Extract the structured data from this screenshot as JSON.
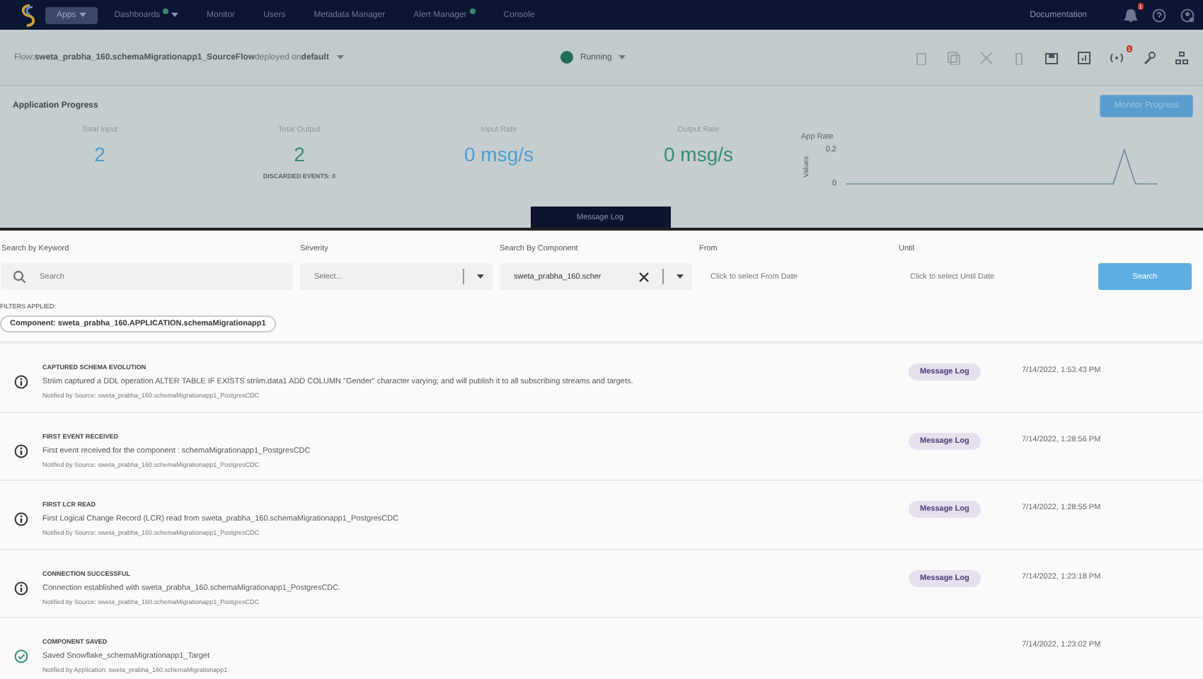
{
  "nav": {
    "items": [
      {
        "label": "Apps",
        "selected": true,
        "caret": true,
        "dot": false
      },
      {
        "label": "Dashboards",
        "selected": false,
        "caret": true,
        "dot": true
      },
      {
        "label": "Monitor",
        "selected": false,
        "caret": false,
        "dot": false
      },
      {
        "label": "Users",
        "selected": false,
        "caret": false,
        "dot": false
      },
      {
        "label": "Metadata Manager",
        "selected": false,
        "caret": false,
        "dot": false
      },
      {
        "label": "Alert Manager",
        "selected": false,
        "caret": false,
        "dot": true
      },
      {
        "label": "Console",
        "selected": false,
        "caret": false,
        "dot": false
      }
    ],
    "documentation": "Documentation",
    "bell_badge": "1"
  },
  "flow_bar": {
    "flow_label": "Flow:",
    "flow_name": "sweta_prabha_160.schemaMigrationapp1_SourceFlow",
    "deployed_on": "deployed on",
    "target": "default",
    "status": "Running",
    "toolbar_badge": "1"
  },
  "progress": {
    "title": "Application Progress",
    "button": "Monitor Progress",
    "stats": [
      {
        "label": "Total Input",
        "value": "2",
        "color": "#4a9fd0"
      },
      {
        "label": "Total Output",
        "value": "2",
        "color": "#2e8f75",
        "note": "DISCARDED EVENTS: 0"
      },
      {
        "label": "Input Rate",
        "value": "0 msg/s",
        "color": "#4a9fd0"
      },
      {
        "label": "Output Rate",
        "value": "0 msg/s",
        "color": "#2e8f75"
      }
    ],
    "chart_data": {
      "type": "line",
      "title": "App Rate",
      "ylabel": "Values",
      "yticks": [
        0,
        0.2
      ],
      "ylim": [
        0,
        0.2
      ],
      "series": [
        {
          "color": "#6a8a9a",
          "values": [
            0,
            0,
            0,
            0,
            0,
            0,
            0,
            0,
            0,
            0,
            0,
            0,
            0,
            0,
            0,
            0,
            0,
            0,
            0,
            0,
            0,
            0,
            0,
            0,
            0,
            0.2,
            0,
            0,
            0
          ]
        }
      ]
    }
  },
  "log_tab": "Message Log",
  "filters": {
    "keyword": {
      "label": "Search by Keyword",
      "placeholder": "Search"
    },
    "severity": {
      "label": "Severity",
      "placeholder": "Select..."
    },
    "component": {
      "label": "Search By Component",
      "value": "sweta_prabha_160.scher"
    },
    "from": {
      "label": "From",
      "placeholder": "Click to select From Date"
    },
    "until": {
      "label": "Until",
      "placeholder": "Click to select Until Date"
    },
    "search_button": "Search",
    "applied_label": "FILTERS APPLIED:",
    "applied": [
      "Component: sweta_prabha_160.APPLICATION.schemaMigrationapp1"
    ]
  },
  "events": [
    {
      "kind": "info",
      "title": "CAPTURED SCHEMA EVOLUTION",
      "message": "Striim captured a DDL operation ALTER TABLE IF EXISTS striim.data1 ADD COLUMN \"Gender\" character varying; and will publish it to all subscribing streams and targets.",
      "source": "Notified by Source: sweta_prabha_160.schemaMigrationapp1_PostgresCDC",
      "button": "Message Log",
      "time": "7/14/2022, 1:53:43 PM"
    },
    {
      "kind": "info",
      "title": "FIRST EVENT RECEIVED",
      "message": "First event received for the component : schemaMigrationapp1_PostgresCDC",
      "source": "Notified by Source: sweta_prabha_160.schemaMigrationapp1_PostgresCDC",
      "button": "Message Log",
      "time": "7/14/2022, 1:28:56 PM"
    },
    {
      "kind": "info",
      "title": "FIRST LCR READ",
      "message": "First Logical Change Record (LCR) read from sweta_prabha_160.schemaMigrationapp1_PostgresCDC",
      "source": "Notified by Source: sweta_prabha_160.schemaMigrationapp1_PostgresCDC",
      "button": "Message Log",
      "time": "7/14/2022, 1:28:55 PM"
    },
    {
      "kind": "info",
      "title": "CONNECTION SUCCESSFUL",
      "message": "Connection established with sweta_prabha_160.schemaMigrationapp1_PostgresCDC.",
      "source": "Notified by Source: sweta_prabha_160.schemaMigrationapp1_PostgresCDC",
      "button": "Message Log",
      "time": "7/14/2022, 1:23:18 PM"
    },
    {
      "kind": "success",
      "title": "COMPONENT SAVED",
      "message": "Saved Snowflake_schemaMigrationapp1_Target",
      "source": "Notified by Application: sweta_prabha_160.schemaMigrationapp1",
      "time": "7/14/2022, 1:23:02 PM"
    }
  ]
}
